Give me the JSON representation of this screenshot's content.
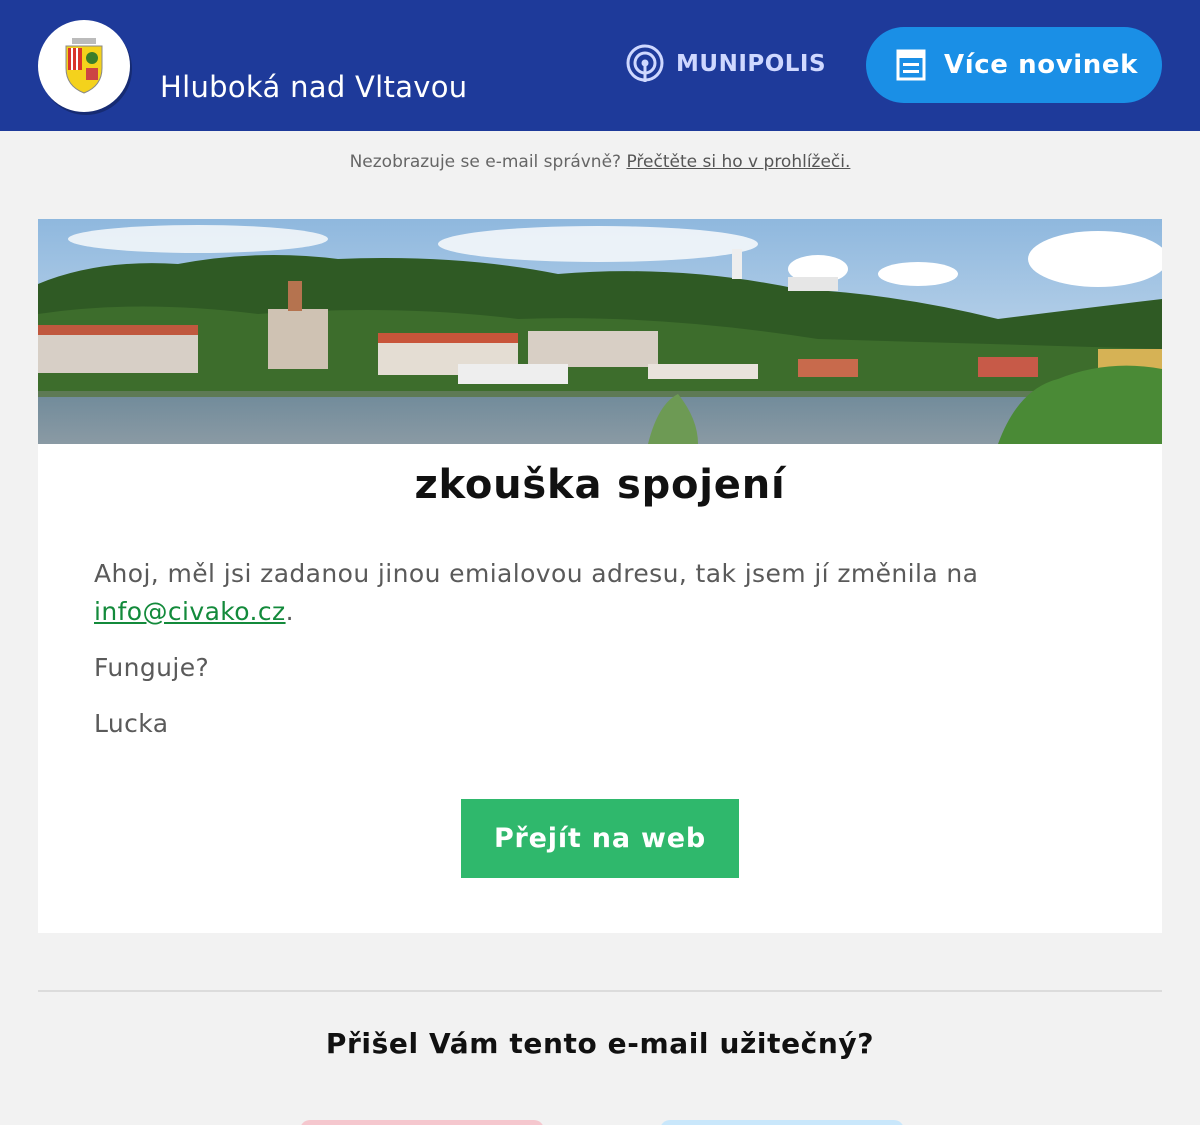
{
  "header": {
    "town_name": "Hluboká nad Vltavou",
    "brand": "MUNIPOLIS",
    "more_news_label": "Více novinek",
    "bg_color": "#1e3a9a",
    "button_color": "#1a8fe6"
  },
  "notice": {
    "text": "Nezobrazuje se e-mail správně?",
    "link": "Přečtěte si ho v prohlížeči."
  },
  "article": {
    "title": "zkouška spojení",
    "paragraph1_text": "Ahoj, měl jsi zadanou jinou emialovou adresu, tak jsem jí změnila na",
    "email_link": "info@civako.cz",
    "paragraph1_end": ".",
    "paragraph2": "Funguje?",
    "signature": "Lucka",
    "cta_label": "Přejít na web",
    "cta_color": "#2fb86c"
  },
  "feedback": {
    "question": "Přišel Vám tento e-mail užitečný?"
  },
  "icons": [
    "coat-of-arms",
    "broadcast-icon",
    "newspaper-icon"
  ]
}
